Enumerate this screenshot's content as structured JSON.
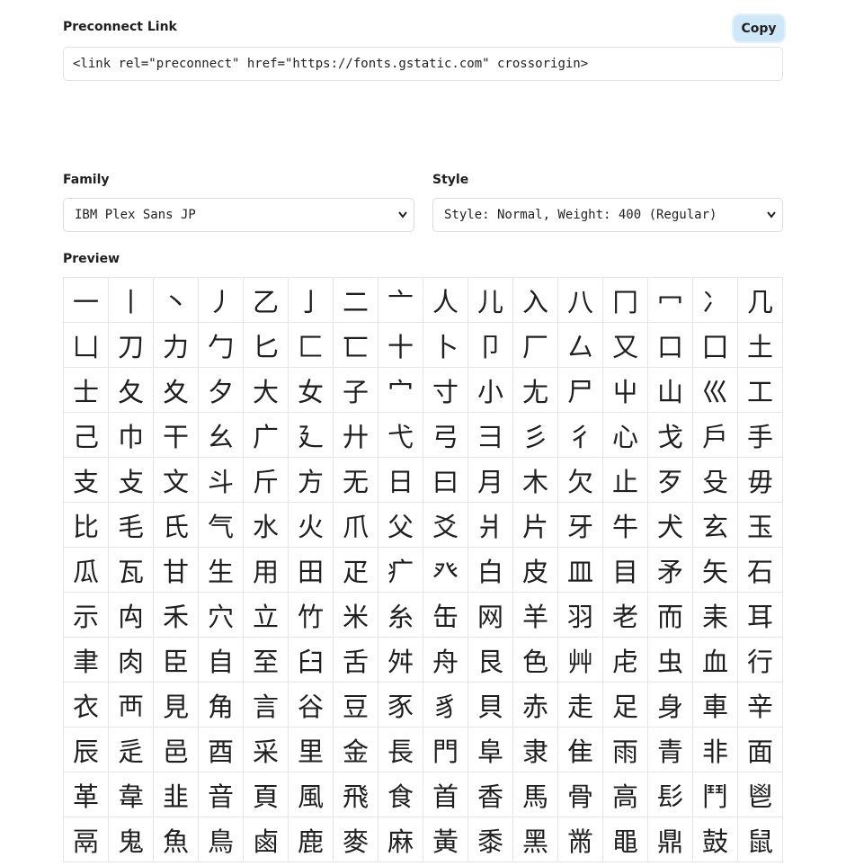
{
  "preconnect": {
    "label": "Preconnect Link",
    "copy_label": "Copy",
    "code": "<link rel=\"preconnect\" href=\"https://fonts.gstatic.com\" crossorigin>"
  },
  "family": {
    "label": "Family",
    "value": "IBM Plex Sans JP"
  },
  "style": {
    "label": "Style",
    "value": "Style: Normal, Weight: 400 (Regular)"
  },
  "preview": {
    "label": "Preview",
    "rows": [
      "一丨丶丿乙亅二亠人儿入八冂冖冫几",
      "凵刀力勹匕匚匸十卜卩厂厶又口囗土",
      "士夂夊夕大女子宀寸小尢尸屮山巛工",
      "己巾干幺广廴廾弋弓彐彡彳心戈戶手",
      "支攴文斗斤方无日曰月木欠止歹殳毋",
      "比毛氏气水火爪父爻爿片牙牛犬玄玉",
      "瓜瓦甘生用田疋疒癶白皮皿目矛矢石",
      "示禸禾穴立竹米糸缶网羊羽老而耒耳",
      "聿肉臣自至臼舌舛舟艮色艸虍虫血行",
      "衣襾見角言谷豆豕豸貝赤走足身車辛",
      "辰辵邑酉采里金長門阜隶隹雨青非面",
      "革韋韭音頁風飛食首香馬骨高髟鬥鬯",
      "鬲鬼魚鳥鹵鹿麥麻黃黍黑黹黽鼎鼓鼠"
    ]
  }
}
